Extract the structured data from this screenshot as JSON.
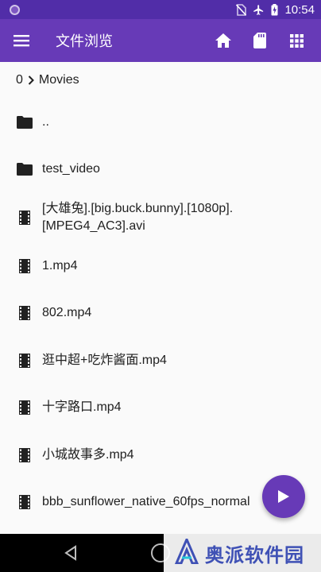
{
  "status_bar": {
    "time": "10:54",
    "icons": [
      "no-sim-icon",
      "airplane-icon",
      "battery-charging-icon"
    ]
  },
  "app_bar": {
    "menu_icon": "menu-icon",
    "title": "文件浏览",
    "actions": [
      "home-icon",
      "sd-card-icon",
      "grid-icon"
    ]
  },
  "breadcrumb": {
    "root": "0",
    "folder": "Movies"
  },
  "files": [
    {
      "name": "..",
      "icon": "folder-icon"
    },
    {
      "name": "test_video",
      "icon": "folder-icon"
    },
    {
      "name": "[大雄兔].[big.buck.bunny].[1080p].[MPEG4_AC3].avi",
      "icon": "film-icon"
    },
    {
      "name": "1.mp4",
      "icon": "film-icon"
    },
    {
      "name": "802.mp4",
      "icon": "film-icon"
    },
    {
      "name": "逛中超+吃炸酱面.mp4",
      "icon": "film-icon"
    },
    {
      "name": "十字路口.mp4",
      "icon": "film-icon"
    },
    {
      "name": "小城故事多.mp4",
      "icon": "film-icon"
    },
    {
      "name": "bbb_sunflower_native_60fps_normal",
      "icon": "film-icon"
    }
  ],
  "fab": {
    "icon": "play-icon"
  },
  "nav_bar": {
    "icons": [
      "back-icon",
      "home-circle-icon"
    ]
  },
  "watermark": {
    "text": "奥派软件园"
  },
  "colors": {
    "status_bar": "#512da8",
    "app_bar": "#673ab7",
    "fab": "#673ab7",
    "text": "#212121"
  }
}
